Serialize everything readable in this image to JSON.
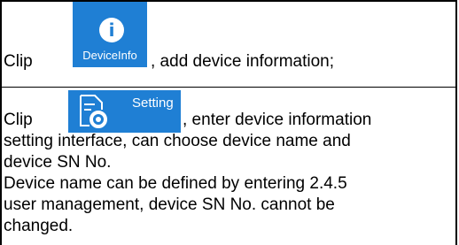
{
  "rows": [
    {
      "prefix": "Clip",
      "icon_label": "DeviceInfo",
      "icon": "info-circle-icon",
      "suffix": ", add device information;"
    },
    {
      "prefix": "Clip",
      "icon_label": "Setting",
      "icon": "settings-document-icon",
      "suffix": ", enter device information",
      "continuation": [
        "setting interface, can choose device name and",
        "device SN No.",
        "Device name can be defined by entering 2.4.5",
        "user management, device SN No. cannot be",
        "changed."
      ]
    }
  ],
  "colors": {
    "accent": "#1f7fd4"
  }
}
